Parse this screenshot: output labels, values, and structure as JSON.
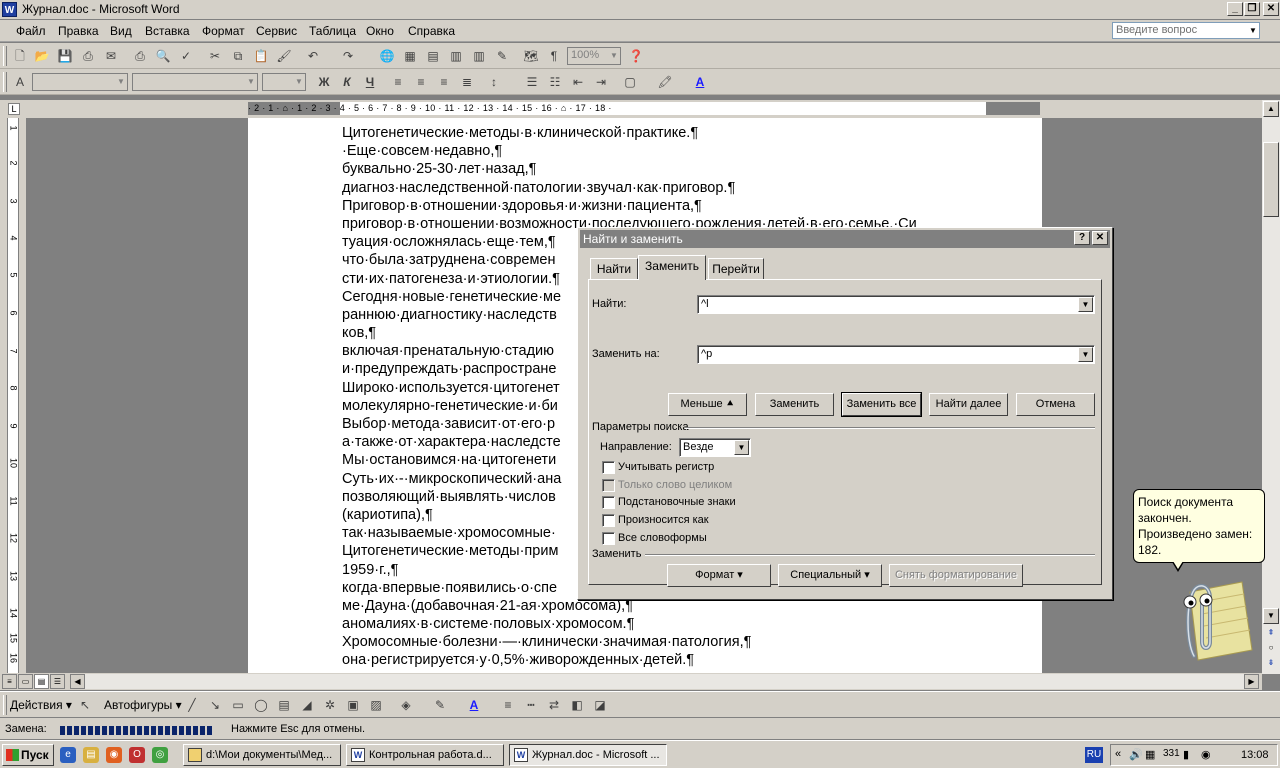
{
  "window": {
    "title": "Журнал.doc - Microsoft Word",
    "app_icon": "W",
    "caption_buttons": [
      "_",
      "❐",
      "✕"
    ]
  },
  "menu": {
    "items": [
      "Файл",
      "Правка",
      "Вид",
      "Вставка",
      "Формат",
      "Сервис",
      "Таблица",
      "Окно",
      "Справка"
    ],
    "ask_placeholder": "Введите вопрос"
  },
  "standard_toolbar": {
    "zoom": "100%"
  },
  "format_toolbar": {
    "bold": "Ж",
    "italic": "К",
    "underline": "Ч"
  },
  "ruler": {
    "numbers": "· 2 · 1 · ⌂ · 1 · 2 · 3 · 4 · 5 · 6 · 7 · 8 · 9 · 10 · 11 · 12 · 13 · 14 · 15 · 16 · ⌂ · 17 · 18 ·"
  },
  "vruler": [
    "1",
    "2",
    "3",
    "4",
    "5",
    "6",
    "7",
    "8",
    "9",
    "10",
    "11",
    "12",
    "13",
    "14",
    "15",
    "16"
  ],
  "document": {
    "lines": [
      "Цитогенетические·методы·в·клинической·практике.¶",
      "·Еще·совсем·недавно,¶",
      "буквально·25-30·лет·назад,¶",
      "диагноз·наследственной·патологии·звучал·как·приговор.¶",
      "Приговор·в·отношении·здоровья·и·жизни·пациента,¶",
      "приговор·в·отношении·возможности·последующего·рождения·детей·в·его·семье.·Си",
      "туация·осложнялась·еще·тем,¶",
      "что·была·затруднена·современ",
      "сти·их·патогенеза·и·этиологии.¶",
      "Сегодня·новые·генетические·ме",
      "раннюю·диагностику·наследств",
      "ков,¶",
      "включая·пренатальную·стадию",
      "и·предупреждать·распростране",
      "Широко·используется·цитогенет",
      "молекулярно-генетические·и·би",
      "Выбор·метода·зависит·от·его·р",
      "а·также·от·характера·наследсте",
      "Мы·остановимся·на·цитогенети",
      "Суть·их·-·микроскопический·ана",
      "позволяющий·выявлять·числов",
      "(кариотипа),¶",
      "так·называемые·хромосомные·",
      "Цитогенетические·методы·прим",
      "1959·г.,¶",
      "когда·впервые·появились·о·спе",
      "ме·Дауна·(добавочная·21-ая·хромосома),¶",
      "аномалиях·в·системе·половых·хромосом.¶",
      "Хромосомные·болезни·—·клинически·значимая·патология,¶",
      "она·регистрируется·у·0,5%·живорожденных·детей.¶"
    ]
  },
  "dialog": {
    "title": "Найти и заменить",
    "help": "?",
    "close": "✕",
    "tabs": [
      "Найти",
      "Заменить",
      "Перейти"
    ],
    "find_label": "Найти:",
    "find_value": "^l",
    "replace_label": "Заменить на:",
    "replace_value": "^p",
    "buttons": {
      "less": "Меньше ⯅",
      "replace": "Заменить",
      "replace_all": "Заменить все",
      "find_next": "Найти далее",
      "cancel": "Отмена"
    },
    "search_params_label": "Параметры поиска",
    "direction_label": "Направление:",
    "direction_value": "Везде",
    "options": [
      "Учитывать регистр",
      "Только слово целиком",
      "Подстановочные знаки",
      "Произносится как",
      "Все словоформы"
    ],
    "replace_section_label": "Заменить",
    "bottom_buttons": {
      "format": "Формат ▾",
      "special": "Специальный ▾",
      "no_format": "Снять форматирование"
    }
  },
  "assistant": {
    "message": "Поиск документа закончен. Произведено замен: 182."
  },
  "drawing_toolbar": {
    "actions": "Действия ▾",
    "autoshapes": "Автофигуры ▾"
  },
  "status": {
    "label": "Замена:",
    "progress": 0.95,
    "hint": "Нажмите Esc для отмены."
  },
  "taskbar": {
    "start": "Пуск",
    "tasks": [
      "d:\\Мои документы\\Мед...",
      "Контрольная работа.d...",
      "Журнал.doc - Microsoft ..."
    ],
    "lang": "RU",
    "clock": "13:08",
    "tray_num": "331"
  }
}
